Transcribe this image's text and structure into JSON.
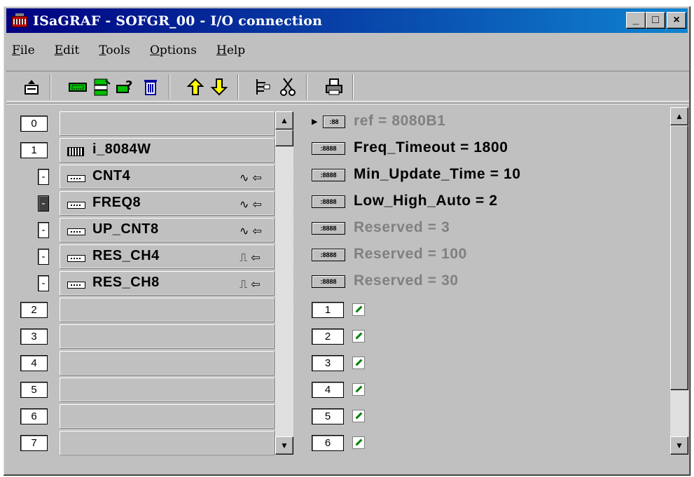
{
  "window": {
    "title": "ISaGRAF - SOFGR_00 - I/O connection",
    "minimize": "_",
    "maximize": "□",
    "close": "×"
  },
  "menu": [
    {
      "u": "F",
      "rest": "ile"
    },
    {
      "u": "E",
      "rest": "dit"
    },
    {
      "u": "T",
      "rest": "ools"
    },
    {
      "u": "O",
      "rest": "ptions"
    },
    {
      "u": "H",
      "rest": "elp"
    }
  ],
  "toolbar": {
    "icons": [
      "export-icon",
      "board-icon",
      "configure-icon",
      "help-icon",
      "delete-icon",
      "arrow-up-icon",
      "arrow-down-icon",
      "structure-icon",
      "cut-icon",
      "print-icon"
    ]
  },
  "slots": [
    {
      "num": "0",
      "label": ""
    },
    {
      "num": "1",
      "label": "i_8084W"
    },
    {
      "num": "2",
      "label": ""
    },
    {
      "num": "3",
      "label": ""
    },
    {
      "num": "4",
      "label": ""
    },
    {
      "num": "5",
      "label": ""
    },
    {
      "num": "6",
      "label": ""
    },
    {
      "num": "7",
      "label": ""
    }
  ],
  "channels": [
    {
      "box": "-",
      "label": "CNT4",
      "signal": "∿ ⇦",
      "selected": false
    },
    {
      "box": "-",
      "label": "FREQ8",
      "signal": "∿ ⇦",
      "selected": true
    },
    {
      "box": "-",
      "label": "UP_CNT8",
      "signal": "∿ ⇦",
      "selected": false
    },
    {
      "box": "-",
      "label": "RES_CH4",
      "signal": "⎍ ⇦",
      "selected": false
    },
    {
      "box": "-",
      "label": "RES_CH8",
      "signal": "⎍ ⇦",
      "selected": false
    }
  ],
  "params": {
    "ref_icon_text": ":88",
    "param_icon_text": ":8888",
    "ref": "ref = 8080B1",
    "items": [
      {
        "text": "Freq_Timeout = 1800",
        "active": true
      },
      {
        "text": "Min_Update_Time = 10",
        "active": true
      },
      {
        "text": "Low_High_Auto = 2",
        "active": true
      },
      {
        "text": "Reserved = 3",
        "active": false
      },
      {
        "text": "Reserved = 100",
        "active": false
      },
      {
        "text": "Reserved = 30",
        "active": false
      }
    ]
  },
  "equipments": [
    "1",
    "2",
    "3",
    "4",
    "5",
    "6"
  ],
  "scroll": {
    "up": "▲",
    "down": "▼"
  },
  "colors": {
    "title_start": "#000080",
    "title_end": "#1084d0",
    "face": "#c0c0c0",
    "inactive_text": "#808080"
  }
}
